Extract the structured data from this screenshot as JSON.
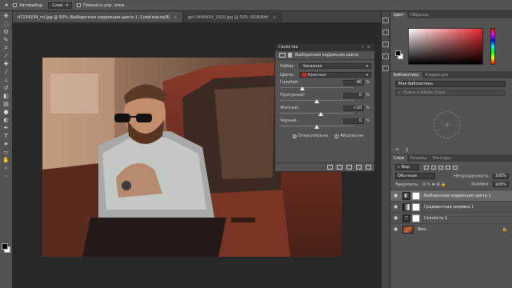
{
  "options_bar": {
    "autoselect_label": "Автовыбор:",
    "autoselect_value": "Слой",
    "show_controls_label": "Показать упр. элем."
  },
  "doc_tabs": [
    {
      "title": "47234234_mi.jpg @ 50% (Выборочная коррекция цвета 1, Слой-маска/8)",
      "close": "×"
    },
    {
      "title": "girl-1848454_1920.jpg @ 50% (RGB/8#)",
      "close": "×"
    }
  ],
  "properties": {
    "panel_title": "Свойства",
    "layer_type": "Выборочная коррекция цвета",
    "preset_label": "Набор:",
    "preset_value": "Заказная",
    "colors_label": "Цвета:",
    "colors_value": "Красные",
    "sliders": [
      {
        "label": "Голубой:",
        "value": "-40",
        "fraction": 0.3
      },
      {
        "label": "Пурпурный:",
        "value": "0",
        "fraction": 0.5
      },
      {
        "label": "Желтый:",
        "value": "+10",
        "fraction": 0.55
      },
      {
        "label": "Черный:",
        "value": "0",
        "fraction": 0.5
      }
    ],
    "percent": "%",
    "relative_label": "Относительно",
    "absolute_label": "Абсолютно",
    "method_selected": "relative"
  },
  "right_panels": {
    "color_tab": "Цвет",
    "swatches_tab": "Образцы",
    "libraries_tab": "Библиотеки",
    "adjustments_tab": "Коррекция",
    "library_name": "Моя библиотека",
    "library_search_placeholder": "Поиск в Adobe Stock",
    "layers_tab": "Слои",
    "channels_tab": "Каналы",
    "paths_tab": "Контуры",
    "kind_label": "Вид",
    "blend_mode": "Обычные",
    "opacity_label": "Непрозрачность:",
    "opacity_value": "100%",
    "lock_label": "Закрепить:",
    "fill_label": "Заливка:",
    "fill_value": "100%",
    "layers": [
      {
        "name": "Выборочная коррекция цвета 1",
        "kind": "adjustment",
        "selected": true
      },
      {
        "name": "Градиентная заливка 1",
        "kind": "gradient",
        "selected": false
      },
      {
        "name": "Сочность 1",
        "kind": "adjustment",
        "selected": false
      },
      {
        "name": "Фон",
        "kind": "photo",
        "selected": false
      }
    ]
  },
  "colors": {
    "ui_dark": "#282828",
    "panel": "#535353",
    "accent_red": "#e02020"
  }
}
